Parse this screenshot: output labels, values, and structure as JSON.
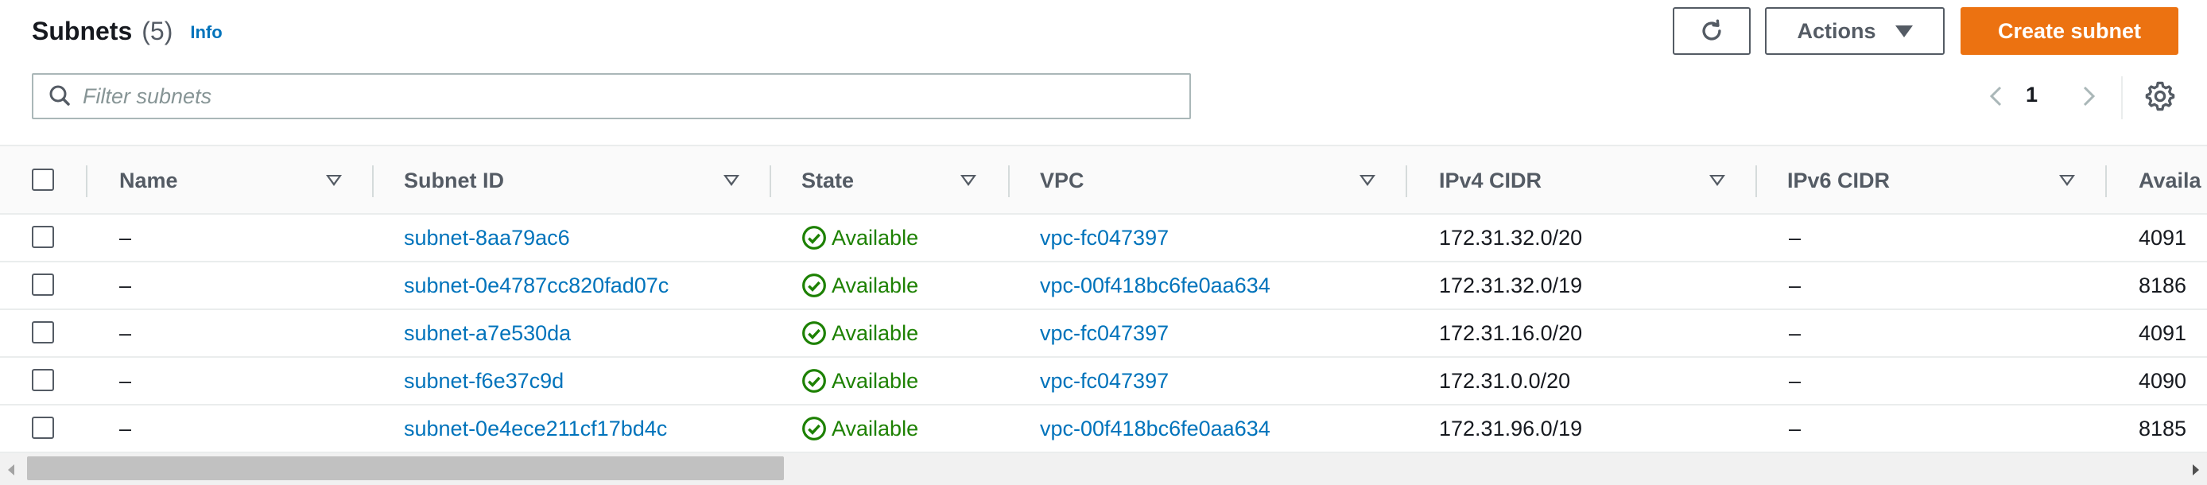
{
  "header": {
    "title": "Subnets",
    "count": "(5)",
    "info_label": "Info",
    "actions_label": "Actions",
    "create_label": "Create subnet"
  },
  "filter": {
    "placeholder": "Filter subnets",
    "value": ""
  },
  "pagination": {
    "current_page": "1"
  },
  "table": {
    "columns": [
      "Name",
      "Subnet ID",
      "State",
      "VPC",
      "IPv4 CIDR",
      "IPv6 CIDR",
      "Availa"
    ],
    "rows": [
      {
        "name": "–",
        "subnet_id": "subnet-8aa79ac6",
        "state": "Available",
        "vpc": "vpc-fc047397",
        "ipv4": "172.31.32.0/20",
        "ipv6": "–",
        "available": "4091"
      },
      {
        "name": "–",
        "subnet_id": "subnet-0e4787cc820fad07c",
        "state": "Available",
        "vpc": "vpc-00f418bc6fe0aa634",
        "ipv4": "172.31.32.0/19",
        "ipv6": "–",
        "available": "8186"
      },
      {
        "name": "–",
        "subnet_id": "subnet-a7e530da",
        "state": "Available",
        "vpc": "vpc-fc047397",
        "ipv4": "172.31.16.0/20",
        "ipv6": "–",
        "available": "4091"
      },
      {
        "name": "–",
        "subnet_id": "subnet-f6e37c9d",
        "state": "Available",
        "vpc": "vpc-fc047397",
        "ipv4": "172.31.0.0/20",
        "ipv6": "–",
        "available": "4090"
      },
      {
        "name": "–",
        "subnet_id": "subnet-0e4ece211cf17bd4c",
        "state": "Available",
        "vpc": "vpc-00f418bc6fe0aa634",
        "ipv4": "172.31.96.0/19",
        "ipv6": "–",
        "available": "8185"
      }
    ]
  },
  "colors": {
    "primary": "#ec7211",
    "link": "#0073bb",
    "success": "#1d8102",
    "text": "#16191f",
    "muted": "#545b64"
  },
  "icons": {
    "refresh": "refresh-icon",
    "search": "search-icon",
    "settings": "gear-icon",
    "status": "check-circle-icon"
  }
}
